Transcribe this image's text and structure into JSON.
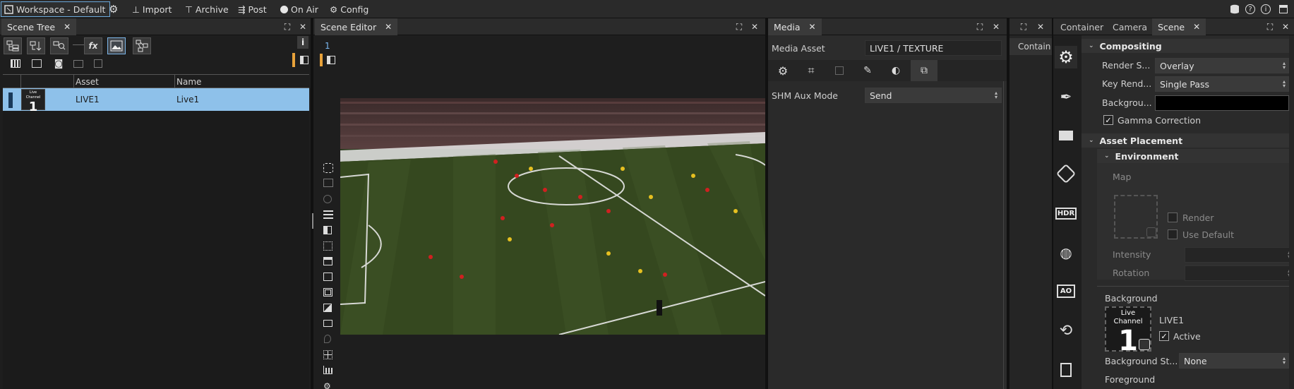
{
  "toolbar": {
    "workspace": "Workspace - Default",
    "import": "Import",
    "archive": "Archive",
    "post": "Post",
    "on_air": "On Air",
    "config": "Config"
  },
  "scene_tree": {
    "tab": "Scene Tree",
    "columns": [
      "Asset",
      "Name"
    ],
    "rows": [
      {
        "thumb_caption": "Live Channel",
        "thumb_number": "1",
        "asset": "LIVE1",
        "name": "Live1"
      }
    ]
  },
  "scene_editor": {
    "tab": "Scene Editor",
    "layer_number": "1"
  },
  "media": {
    "tab": "Media",
    "asset_label": "Media Asset",
    "asset_value": "LIVE1 / TEXTURE",
    "shm_label": "SHM Aux Mode",
    "shm_value": "Send"
  },
  "container_stub": {
    "label": "Contain"
  },
  "right": {
    "tabs": [
      "Container",
      "Camera",
      "Scene"
    ],
    "compositing_title": "Compositing",
    "render_setup_label": "Render S...",
    "render_setup_value": "Overlay",
    "key_render_label": "Key Rend...",
    "key_render_value": "Single Pass",
    "background_label": "Backgrou...",
    "background_color": "#000000",
    "gamma_label": "Gamma Correction",
    "gamma_checked": true,
    "asset_placement_title": "Asset Placement",
    "environment_title": "Environment",
    "map_label": "Map",
    "render_label": "Render",
    "use_default_label": "Use Default",
    "intensity_label": "Intensity",
    "rotation_label": "Rotation",
    "bg_section_label": "Background",
    "bg_thumb_caption": "Live Channel",
    "bg_thumb_number": "1",
    "bg_asset_name": "LIVE1",
    "active_label": "Active",
    "active_checked": true,
    "bg_style_label": "Background St...",
    "bg_style_value": "None",
    "foreground_label": "Foreground",
    "side_icons": [
      "gear-icon",
      "pen-icon",
      "layers-icon",
      "camera-icon",
      "hdr-icon",
      "globe-icon",
      "ao-icon",
      "refresh-icon",
      "export-icon"
    ],
    "hdr_text": "HDR",
    "ao_text": "AO"
  },
  "colors": {
    "selection": "#8ec1ea",
    "panel_bg": "#1e1e1e",
    "header_bg": "#2b2b2b"
  }
}
